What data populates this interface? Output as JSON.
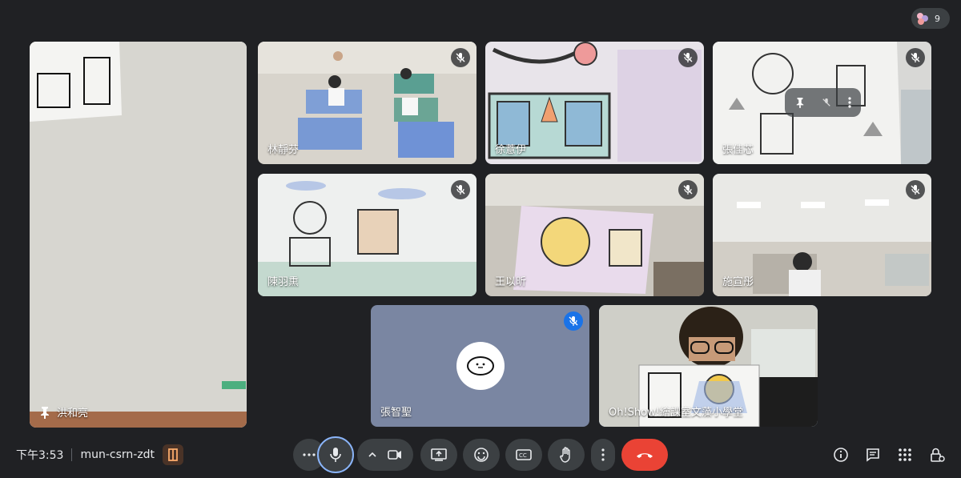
{
  "participant_count": "9",
  "participants": [
    {
      "name": "洪和亮",
      "pinned": true
    },
    {
      "name": "林靜芬",
      "muted": true
    },
    {
      "name": "徐薏伊",
      "muted": true
    },
    {
      "name": "張佳芯",
      "muted": true
    },
    {
      "name": "陳羽熏",
      "muted": true
    },
    {
      "name": "王以昕",
      "muted": true
    },
    {
      "name": "施宣彤",
      "muted": true
    },
    {
      "name": "張智聖",
      "muted": true
    },
    {
      "name": "Oh!Show!繪課室文藻小學堂",
      "speaking": true
    }
  ],
  "meeting": {
    "time": "下午3:53",
    "code": "mun-csrn-zdt"
  },
  "colors": {
    "background": "#202124",
    "tile": "#3c4043",
    "end_call": "#ea4335",
    "accent": "#8ab4f8"
  }
}
